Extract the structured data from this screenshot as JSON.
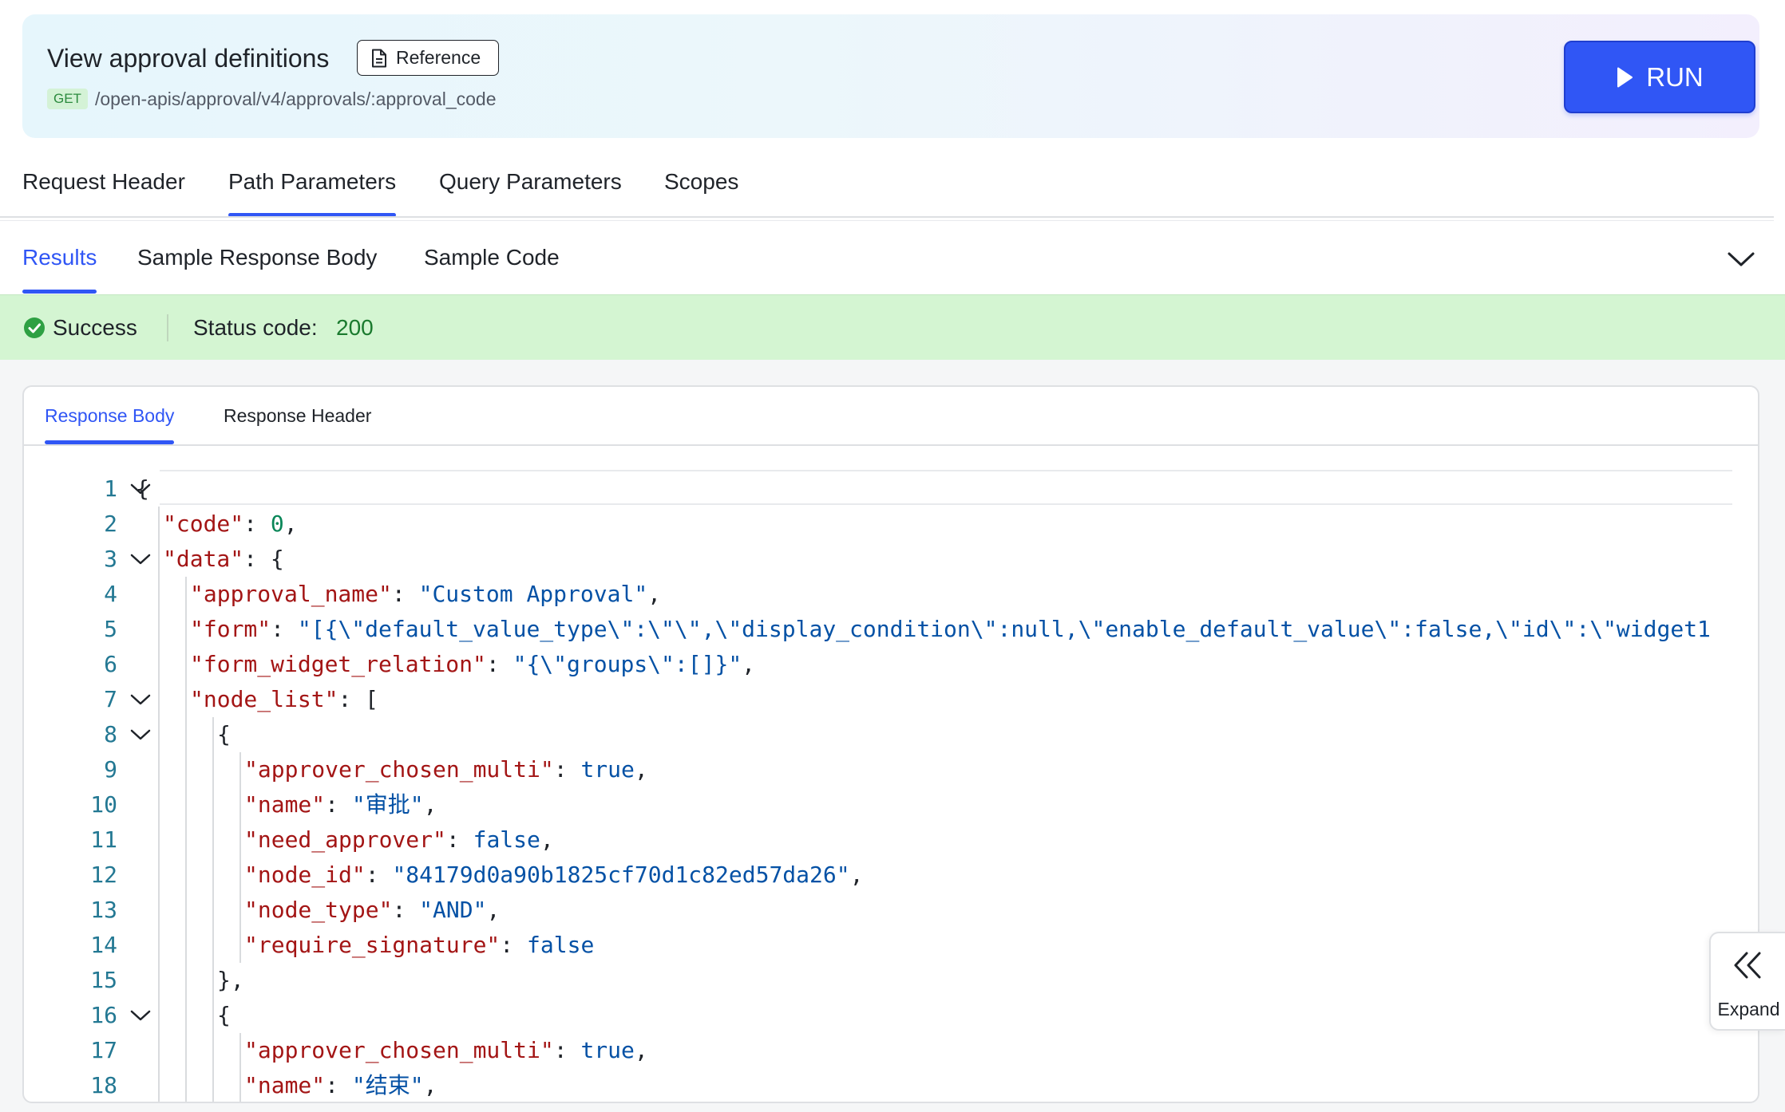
{
  "header": {
    "title": "View approval definitions",
    "reference_label": "Reference",
    "method": "GET",
    "endpoint": "/open-apis/approval/v4/approvals/:approval_code",
    "run_label": "RUN"
  },
  "request_tabs": [
    {
      "label": "Request Header",
      "active": false
    },
    {
      "label": "Path Parameters",
      "active": true
    },
    {
      "label": "Query Parameters",
      "active": false
    },
    {
      "label": "Scopes",
      "active": false
    }
  ],
  "result_tabs": [
    {
      "label": "Results",
      "active": true
    },
    {
      "label": "Sample Response Body",
      "active": false
    },
    {
      "label": "Sample Code",
      "active": false
    }
  ],
  "status": {
    "text": "Success",
    "code_label": "Status code:",
    "code_value": "200",
    "color": "#d4f5d2"
  },
  "response_tabs": [
    {
      "label": "Response Body",
      "active": true
    },
    {
      "label": "Response Header",
      "active": false
    }
  ],
  "code_lines": [
    {
      "n": "1",
      "indent": 0,
      "fold": true,
      "tokens": [
        [
          "p",
          "{"
        ]
      ]
    },
    {
      "n": "2",
      "indent": 1,
      "fold": false,
      "tokens": [
        [
          "k",
          "\"code\""
        ],
        [
          "p",
          ": "
        ],
        [
          "n",
          "0"
        ],
        [
          "p",
          ","
        ]
      ]
    },
    {
      "n": "3",
      "indent": 1,
      "fold": true,
      "tokens": [
        [
          "k",
          "\"data\""
        ],
        [
          "p",
          ": {"
        ]
      ]
    },
    {
      "n": "4",
      "indent": 2,
      "fold": false,
      "tokens": [
        [
          "k",
          "\"approval_name\""
        ],
        [
          "p",
          ": "
        ],
        [
          "s",
          "\"Custom Approval\""
        ],
        [
          "p",
          ","
        ]
      ]
    },
    {
      "n": "5",
      "indent": 2,
      "fold": false,
      "tokens": [
        [
          "k",
          "\"form\""
        ],
        [
          "p",
          ": "
        ],
        [
          "s",
          "\"[{\\\"default_value_type\\\":\\\"\\\",\\\"display_condition\\\":null,\\\"enable_default_value\\\":false,\\\"id\\\":\\\"widget1"
        ]
      ]
    },
    {
      "n": "6",
      "indent": 2,
      "fold": false,
      "tokens": [
        [
          "k",
          "\"form_widget_relation\""
        ],
        [
          "p",
          ": "
        ],
        [
          "s",
          "\"{\\\"groups\\\":[]}\""
        ],
        [
          "p",
          ","
        ]
      ]
    },
    {
      "n": "7",
      "indent": 2,
      "fold": true,
      "tokens": [
        [
          "k",
          "\"node_list\""
        ],
        [
          "p",
          ": ["
        ]
      ]
    },
    {
      "n": "8",
      "indent": 3,
      "fold": true,
      "tokens": [
        [
          "p",
          "{"
        ]
      ]
    },
    {
      "n": "9",
      "indent": 4,
      "fold": false,
      "tokens": [
        [
          "k",
          "\"approver_chosen_multi\""
        ],
        [
          "p",
          ": "
        ],
        [
          "b",
          "true"
        ],
        [
          "p",
          ","
        ]
      ]
    },
    {
      "n": "10",
      "indent": 4,
      "fold": false,
      "tokens": [
        [
          "k",
          "\"name\""
        ],
        [
          "p",
          ": "
        ],
        [
          "s",
          "\"审批\""
        ],
        [
          "p",
          ","
        ]
      ]
    },
    {
      "n": "11",
      "indent": 4,
      "fold": false,
      "tokens": [
        [
          "k",
          "\"need_approver\""
        ],
        [
          "p",
          ": "
        ],
        [
          "b",
          "false"
        ],
        [
          "p",
          ","
        ]
      ]
    },
    {
      "n": "12",
      "indent": 4,
      "fold": false,
      "tokens": [
        [
          "k",
          "\"node_id\""
        ],
        [
          "p",
          ": "
        ],
        [
          "s",
          "\"84179d0a90b1825cf70d1c82ed57da26\""
        ],
        [
          "p",
          ","
        ]
      ]
    },
    {
      "n": "13",
      "indent": 4,
      "fold": false,
      "tokens": [
        [
          "k",
          "\"node_type\""
        ],
        [
          "p",
          ": "
        ],
        [
          "s",
          "\"AND\""
        ],
        [
          "p",
          ","
        ]
      ]
    },
    {
      "n": "14",
      "indent": 4,
      "fold": false,
      "tokens": [
        [
          "k",
          "\"require_signature\""
        ],
        [
          "p",
          ": "
        ],
        [
          "b",
          "false"
        ]
      ]
    },
    {
      "n": "15",
      "indent": 3,
      "fold": false,
      "tokens": [
        [
          "p",
          "},"
        ]
      ]
    },
    {
      "n": "16",
      "indent": 3,
      "fold": true,
      "tokens": [
        [
          "p",
          "{"
        ]
      ]
    },
    {
      "n": "17",
      "indent": 4,
      "fold": false,
      "tokens": [
        [
          "k",
          "\"approver_chosen_multi\""
        ],
        [
          "p",
          ": "
        ],
        [
          "b",
          "true"
        ],
        [
          "p",
          ","
        ]
      ]
    },
    {
      "n": "18",
      "indent": 4,
      "fold": false,
      "tokens": [
        [
          "k",
          "\"name\""
        ],
        [
          "p",
          ": "
        ],
        [
          "s",
          "\"结束\""
        ],
        [
          "p",
          ","
        ]
      ]
    }
  ],
  "expand_label": "Expand",
  "icons": {
    "reference": "document-icon",
    "run": "play-icon",
    "collapse": "chevron-down-icon",
    "success": "check-circle-icon",
    "expand": "double-chevron-left-icon",
    "fold": "chevron-down-icon"
  },
  "colors": {
    "accent": "#3056f5",
    "success": "#2ea043",
    "json_key": "#a31515",
    "json_string": "#0451a5",
    "json_number": "#098658"
  }
}
